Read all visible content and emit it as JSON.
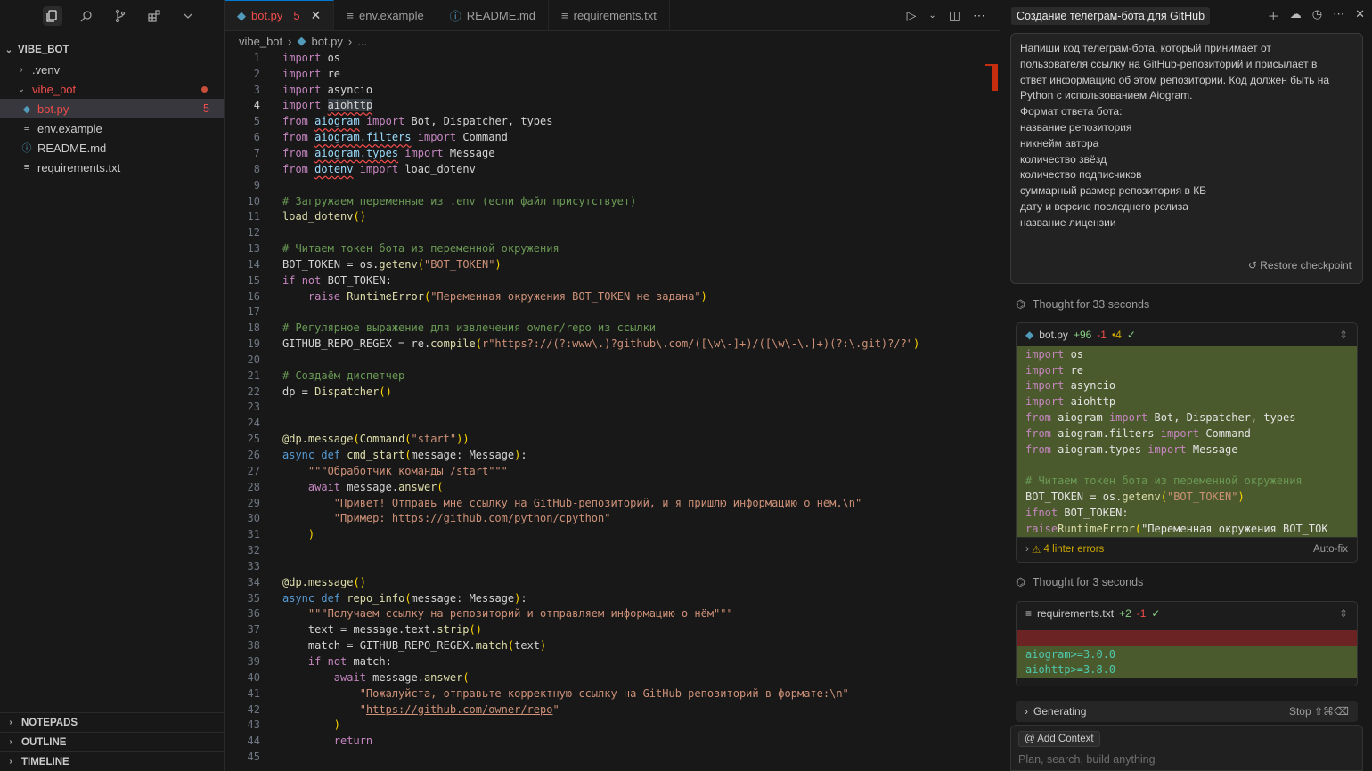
{
  "sidebar": {
    "root": "VIBE_BOT",
    "items": [
      {
        "label": ".venv"
      },
      {
        "label": "vibe_bot"
      },
      {
        "label": "bot.py",
        "badge": "5"
      },
      {
        "label": "env.example"
      },
      {
        "label": "README.md"
      },
      {
        "label": "requirements.txt"
      }
    ],
    "sections": [
      "NOTEPADS",
      "OUTLINE",
      "TIMELINE"
    ]
  },
  "tabs": [
    {
      "label": "bot.py",
      "badge": "5"
    },
    {
      "label": "env.example"
    },
    {
      "label": "README.md"
    },
    {
      "label": "requirements.txt"
    }
  ],
  "breadcrumb": [
    "vibe_bot",
    "bot.py",
    "..."
  ],
  "code": {
    "current_line": 4,
    "lines": [
      "import os",
      "import re",
      "import asyncio",
      "import aiohttp",
      "from aiogram import Bot, Dispatcher, types",
      "from aiogram.filters import Command",
      "from aiogram.types import Message",
      "from dotenv import load_dotenv",
      "",
      "# Загружаем переменные из .env (если файл присутствует)",
      "load_dotenv()",
      "",
      "# Читаем токен бота из переменной окружения",
      "BOT_TOKEN = os.getenv(\"BOT_TOKEN\")",
      "if not BOT_TOKEN:",
      "    raise RuntimeError(\"Переменная окружения BOT_TOKEN не задана\")",
      "",
      "# Регулярное выражение для извлечения owner/repo из ссылки",
      "GITHUB_REPO_REGEX = re.compile(r\"https?://(?:www\\.)?github\\.com/([\\w\\-]+)/([\\w\\-\\.]+)(?:\\.git)?/?\")",
      "",
      "# Создаём диспетчер",
      "dp = Dispatcher()",
      "",
      "",
      "@dp.message(Command(\"start\"))",
      "async def cmd_start(message: Message):",
      "    \"\"\"Обработчик команды /start\"\"\"",
      "    await message.answer(",
      "        \"Привет! Отправь мне ссылку на GitHub-репозиторий, и я пришлю информацию о нём.\\n\"",
      "        \"Пример: https://github.com/python/cpython\"",
      "    )",
      "",
      "",
      "@dp.message()",
      "async def repo_info(message: Message):",
      "    \"\"\"Получаем ссылку на репозиторий и отправляем информацию о нём\"\"\"",
      "    text = message.text.strip()",
      "    match = GITHUB_REPO_REGEX.match(text)",
      "    if not match:",
      "        await message.answer(",
      "            \"Пожалуйста, отправьте корректную ссылку на GitHub-репозиторий в формате:\\n\"",
      "            \"https://github.com/owner/repo\"",
      "        )",
      "        return",
      ""
    ]
  },
  "chat": {
    "title": "Создание телеграм-бота для GitHub",
    "prompt_lines": [
      "Напиши код телеграм-бота, который принимает от",
      "пользователя ссылку на GitHub-репозиторий и присылает в",
      "ответ информацию об этом репозитории. Код должен быть на",
      "Python с использованием Aiogram.",
      "Формат ответа бота:",
      "название репозитория",
      "никнейм автора",
      "количество звёзд",
      "количество подписчиков",
      "суммарный размер репозитория в КБ",
      "дату и версию последнего релиза",
      "название лицензии"
    ],
    "restore_label": "Restore checkpoint",
    "thought1": "Thought for 33 seconds",
    "diff1": {
      "file": "bot.py",
      "added": "+96",
      "removed": "-1",
      "warn": "•4",
      "lines": [
        "import os",
        "import re",
        "import asyncio",
        "import aiohttp",
        "from aiogram import Bot, Dispatcher, types",
        "from aiogram.filters import Command",
        "from aiogram.types import Message",
        "",
        "# Читаем токен бота из переменной окружения",
        "BOT_TOKEN = os.getenv(\"BOT_TOKEN\")",
        "if not BOT_TOKEN:",
        "    raise RuntimeError(\"Переменная окружения BOT_TOK"
      ],
      "footer": "4 linter errors",
      "autofix": "Auto-fix"
    },
    "thought2": "Thought for 3 seconds",
    "diff2": {
      "file": "requirements.txt",
      "added": "+2",
      "removed": "-1",
      "lines": [
        "aiogram>=3.0.0",
        "aiohttp>=3.8.0"
      ]
    },
    "generating": "Generating",
    "stop": "Stop ⇧⌘⌫",
    "add_context": "Add Context",
    "placeholder": "Plan, search, build anything"
  }
}
